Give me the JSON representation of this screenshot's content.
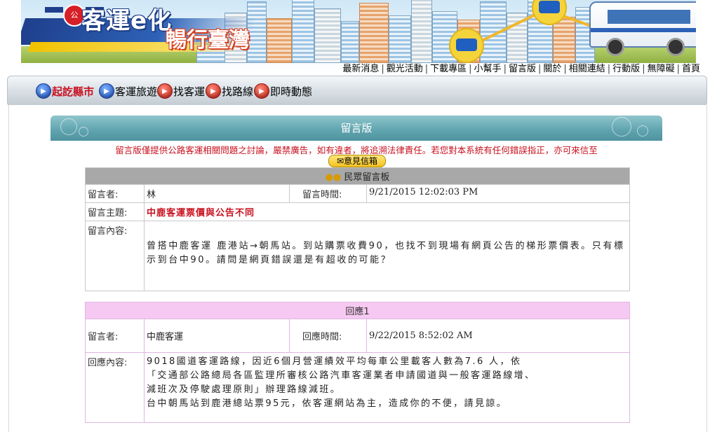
{
  "header": {
    "seal_text": "公",
    "logo_title": "客運e化",
    "logo_subtitle": "暢行臺灣",
    "colors": {
      "brand_blue": "#1f3f8c",
      "brand_yellow": "#f2c200",
      "accent_red": "#c8101e"
    }
  },
  "top_links": [
    "最新消息",
    "觀光活動",
    "下載專區",
    "小幫手",
    "留言版",
    "關於",
    "相關連結",
    "行動版",
    "無障礙",
    "首頁"
  ],
  "nav": {
    "items": [
      {
        "label": "起訖縣市",
        "icon": "blue-arrow-icon",
        "active": true
      },
      {
        "label": "客運旅遊",
        "icon": "blue-arrow-icon"
      },
      {
        "label": "找客運",
        "icon": "red-arrow-icon"
      },
      {
        "label": "找路線",
        "icon": "red-arrow-icon"
      },
      {
        "label": "即時動態",
        "icon": "red-arrow-icon"
      }
    ]
  },
  "board": {
    "title": "留言版",
    "notice": "留言版僅提供公路客運相關問題之討論，嚴禁廣告，如有違者，將追溯法律責任。若您對本系統有任何錯誤指正，亦可來信至",
    "mail_button": "✉意見信箱"
  },
  "message": {
    "section_title": "民眾留言板",
    "author_label": "留言者:",
    "author": "林",
    "time_label": "留言時間:",
    "time": "9/21/2015 12:02:03 PM",
    "subject_label": "留言主題:",
    "subject": "中鹿客運票價與公告不同",
    "content_label": "留言內容:",
    "content": "曾搭中鹿客運 鹿港站→朝馬站。到站購票收費90，也找不到現場有網頁公告的梯形票價表。只有標示到台中90。請問是網頁錯誤還是有超收的可能？"
  },
  "reply": {
    "section_title": "回應1",
    "author_label": "留言者:",
    "author": "中鹿客運",
    "time_label": "回應時間:",
    "time": "9/22/2015 8:52:02 AM",
    "content_label": "回應內容:",
    "content_lines": [
      "9018國道客運路線，因近6個月營運績效平均每車公里載客人數為7.6 人，依",
      "「交通部公路總局各區監理所審核公路汽車客運業者申請國道與一般客運路線增、",
      "減班次及停駛處理原則」辦理路線減班。",
      "台中朝馬站到鹿港總站票95元，依客運網站為主，造成你的不便，請見諒。"
    ]
  }
}
